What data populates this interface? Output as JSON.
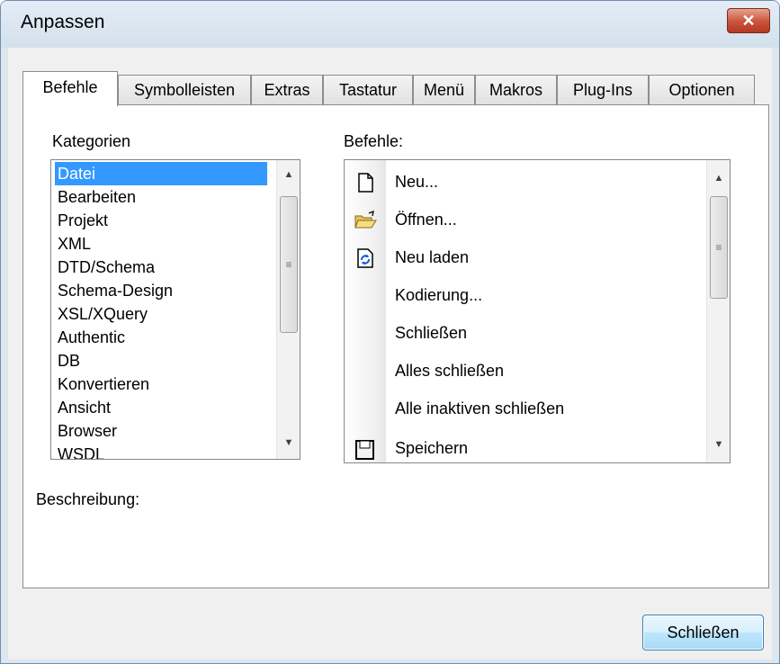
{
  "window": {
    "title": "Anpassen"
  },
  "tabs": [
    {
      "label": "Befehle",
      "active": true
    },
    {
      "label": "Symbolleisten"
    },
    {
      "label": "Extras"
    },
    {
      "label": "Tastatur"
    },
    {
      "label": "Menü"
    },
    {
      "label": "Makros"
    },
    {
      "label": "Plug-Ins"
    },
    {
      "label": "Optionen"
    }
  ],
  "categories": {
    "label": "Kategorien",
    "selected": "Datei",
    "items": [
      "Datei",
      "Bearbeiten",
      "Projekt",
      "XML",
      "DTD/Schema",
      "Schema-Design",
      "XSL/XQuery",
      "Authentic",
      "DB",
      "Konvertieren",
      "Ansicht",
      "Browser",
      "WSDL"
    ]
  },
  "commands": {
    "label": "Befehle:",
    "items": [
      {
        "label": "Neu...",
        "icon": "new-document-icon"
      },
      {
        "label": "Öffnen...",
        "icon": "open-folder-icon"
      },
      {
        "label": "Neu laden",
        "icon": "reload-icon"
      },
      {
        "label": "Kodierung...",
        "icon": ""
      },
      {
        "label": "Schließen",
        "icon": ""
      },
      {
        "label": "Alles schließen",
        "icon": ""
      },
      {
        "label": "Alle inaktiven schließen",
        "icon": ""
      },
      {
        "label": "Speichern",
        "icon": "save-icon"
      }
    ]
  },
  "description": {
    "label": "Beschreibung:"
  },
  "footer": {
    "close_label": "Schließen"
  },
  "colors": {
    "selection": "#3399ff",
    "close_button": "#c9523b",
    "window_frame": "#dce6ef"
  }
}
